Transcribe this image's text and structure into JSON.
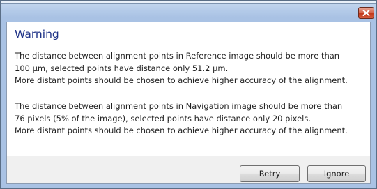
{
  "dialog": {
    "title": "Warning",
    "close_icon": "close-icon",
    "paragraph1": [
      "The distance between alignment points in Reference image should be more than",
      "100 µm, selected points have distance only 51.2 µm.",
      "More distant points should be chosen to achieve higher accuracy of the alignment."
    ],
    "paragraph2": [
      "The distance between alignment points in Navigation image should be more than",
      "76 pixels (5% of the image), selected points have distance only 20 pixels.",
      "More distant points should be chosen to achieve higher accuracy of the alignment."
    ],
    "buttons": {
      "retry": "Retry",
      "ignore": "Ignore"
    }
  },
  "colors": {
    "heading": "#1e3287",
    "close_button": "#c2391c",
    "title_bar": "#b4cbe9"
  }
}
